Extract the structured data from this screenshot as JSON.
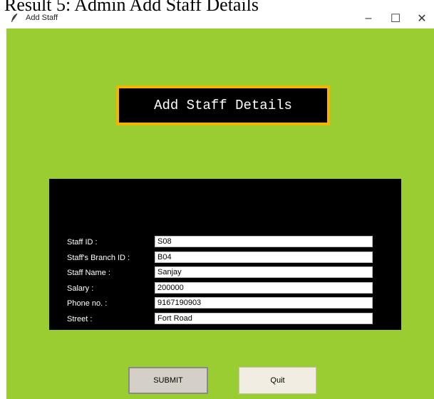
{
  "caption": "Result 5: Admin Add Staff Details",
  "window": {
    "title": "Add Staff",
    "icon": "feather-icon",
    "controls": {
      "minimize": "–",
      "maximize": "☐",
      "close": "✕"
    }
  },
  "colors": {
    "background": "#9acd32",
    "panel": "#000000",
    "heading_border": "#f4b400"
  },
  "heading": "Add Staff Details",
  "form": {
    "fields": [
      {
        "label": "Staff ID :",
        "value": "S08"
      },
      {
        "label": "Staff's Branch ID :",
        "value": "B04"
      },
      {
        "label": "Staff Name :",
        "value": "Sanjay"
      },
      {
        "label": "Salary :",
        "value": "200000"
      },
      {
        "label": "Phone no. :",
        "value": "9167190903"
      },
      {
        "label": "Street :",
        "value": "Fort Road"
      }
    ]
  },
  "buttons": {
    "submit": "SUBMIT",
    "quit": "Quit"
  }
}
